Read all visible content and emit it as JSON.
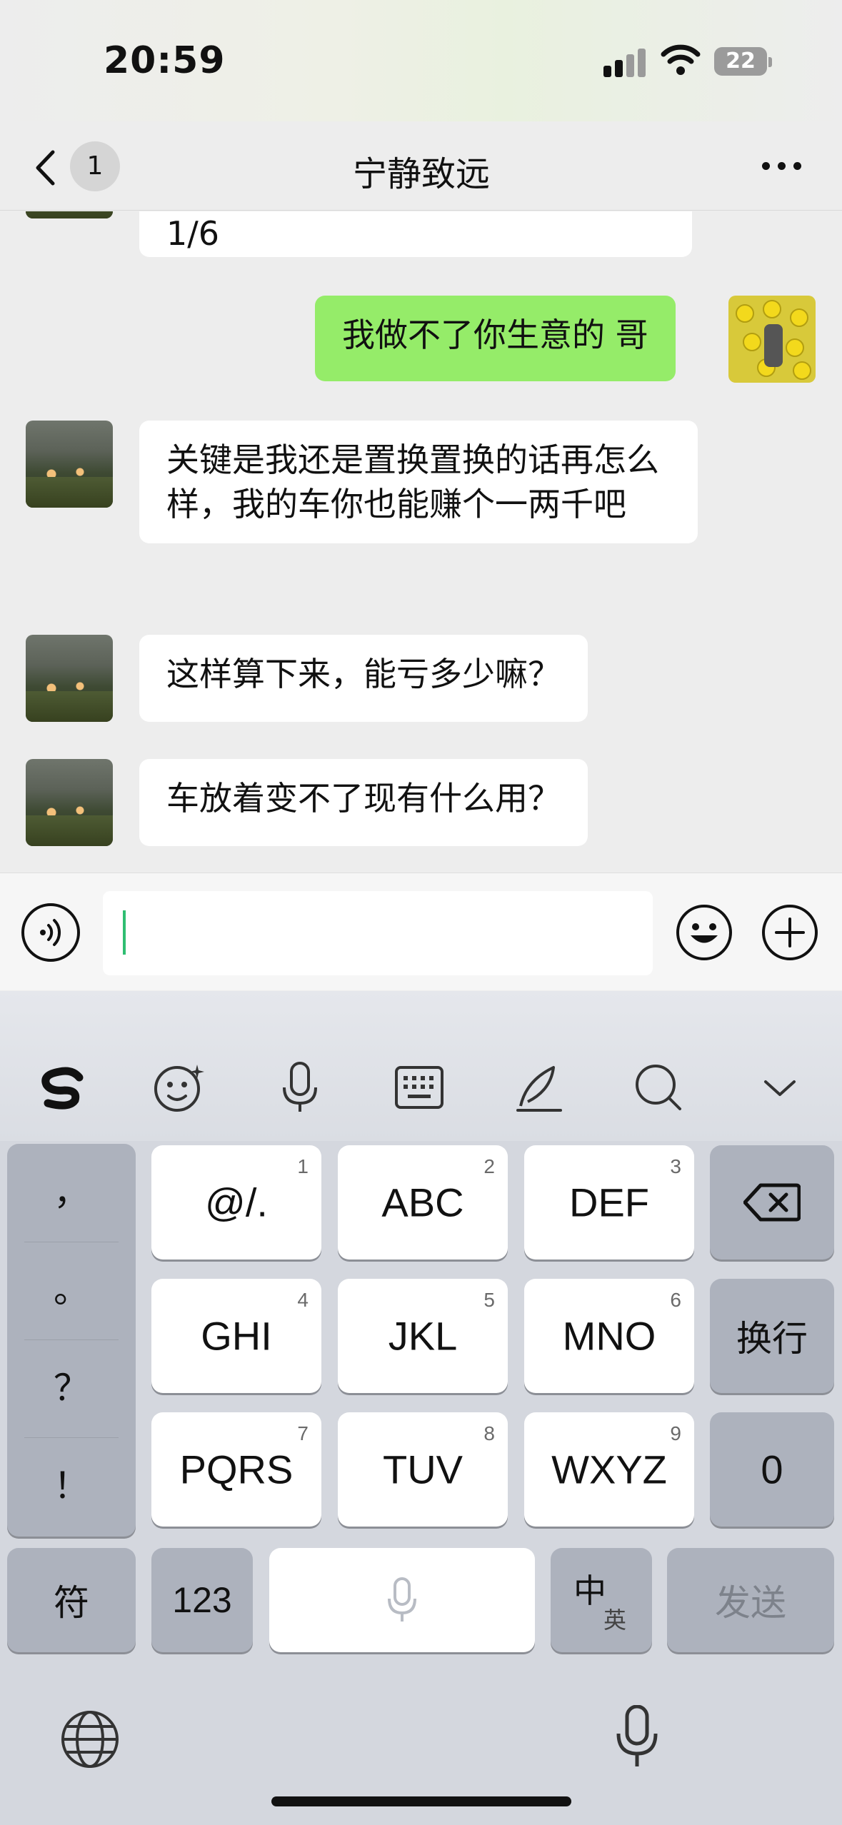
{
  "status": {
    "time": "20:59",
    "battery": "22"
  },
  "header": {
    "unread": "1",
    "title": "宁静致远"
  },
  "messages": [
    {
      "side": "in",
      "text": "1/6",
      "partial": true
    },
    {
      "side": "out",
      "text": "我做不了你生意的 哥"
    },
    {
      "side": "in",
      "text": "关键是我还是置换置换的话再怎么样，我的车你也能赚个一两千吧"
    },
    {
      "side": "in",
      "text": "这样算下来，能亏多少嘛？"
    },
    {
      "side": "in",
      "text": "车放着变不了现有什么用？"
    }
  ],
  "input": {
    "value": ""
  },
  "keyboard": {
    "punctuation": [
      "，",
      "。",
      "？",
      "！"
    ],
    "keys": [
      {
        "label": "@/.",
        "hint": "1"
      },
      {
        "label": "ABC",
        "hint": "2"
      },
      {
        "label": "DEF",
        "hint": "3"
      },
      {
        "label": "GHI",
        "hint": "4"
      },
      {
        "label": "JKL",
        "hint": "5"
      },
      {
        "label": "MNO",
        "hint": "6"
      },
      {
        "label": "PQRS",
        "hint": "7"
      },
      {
        "label": "TUV",
        "hint": "8"
      },
      {
        "label": "WXYZ",
        "hint": "9"
      }
    ],
    "newline": "换行",
    "zero": "0",
    "symbols": "符",
    "numbers": "123",
    "lang_main": "中",
    "lang_alt": "英",
    "send": "发送"
  },
  "colors": {
    "outgoing_bubble": "#95ec69",
    "incoming_bubble": "#ffffff",
    "caret": "#2fbe72"
  }
}
